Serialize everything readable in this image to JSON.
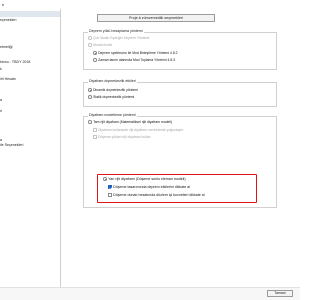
{
  "window": {
    "title": "e"
  },
  "sidebar": {
    "items": [
      {
        "label": "",
        "selected": true
      },
      {
        "label": "eçenekleri"
      },
      {
        "label": ""
      },
      {
        "label": ""
      },
      {
        "label": "etmeliği"
      },
      {
        "label": "ktonu - TBDY 2018"
      },
      {
        "label": "k"
      },
      {
        "label": "irli Hesabı"
      },
      {
        "label": ""
      },
      {
        "label": "a"
      },
      {
        "label": "ri"
      },
      {
        "label": ""
      },
      {
        "label": ""
      },
      {
        "label": "a"
      },
      {
        "label": "ile Seçenekleri"
      },
      {
        "label": ""
      }
    ]
  },
  "main": {
    "preset_button": "Proje â zümvemedlik seçenekleri",
    "group1": {
      "title": "Deprem yükü hesaplama yöntemi",
      "options": [
        {
          "label": "Çok Modlu Eşdeğer Deprem Yöntemi",
          "enabled": false,
          "checked": false
        },
        {
          "label": "Modal Analiz",
          "enabled": false,
          "checked": false
        },
        {
          "label": "Deprem spektrumu ile Mod Birleştirme Yöntemi 4.8.2",
          "enabled": true,
          "checked": true
        },
        {
          "label": "Zaman tanım alanında Mod Toplama Yöntemi 4.8.3",
          "enabled": true,
          "checked": false
        }
      ]
    },
    "group2": {
      "title": "Diyafram dışmerkezlik etkileri",
      "options": [
        {
          "label": "Dinamik dışmerkezlik yöntemi",
          "checked": true
        },
        {
          "label": "Statik dışmerkezlik yöntemi",
          "checked": false
        }
      ]
    },
    "group3": {
      "title": "Diyafram modelleme yöntemi",
      "options": [
        {
          "label": "Tam rijit diyafram (Matematiksel rijit diyafram modeli)",
          "checked": false
        },
        {
          "label": "Diyafram kullanarak rijit diyafram merkezinde yoğunlaştır",
          "checked": false,
          "enabled": false
        },
        {
          "label": "Döşeme yükleri rijit diyafram kullan",
          "checked": false,
          "enabled": false
        },
        {
          "label": "Yarı rijit diyafram (Döşeme sonlu eleman modeli)",
          "checked": true
        },
        {
          "label": "Döşeme tasarımında deprem etkilerini dikkate al",
          "checked": true
        },
        {
          "label": "Döşeme donatı hesabında düzlem içi kuvvetleri dikkate al",
          "checked": false
        }
      ]
    }
  },
  "footer": {
    "ok_button": "Tamam"
  },
  "colors": {
    "highlight": "#e0141e",
    "selection": "#1e5fbf"
  }
}
